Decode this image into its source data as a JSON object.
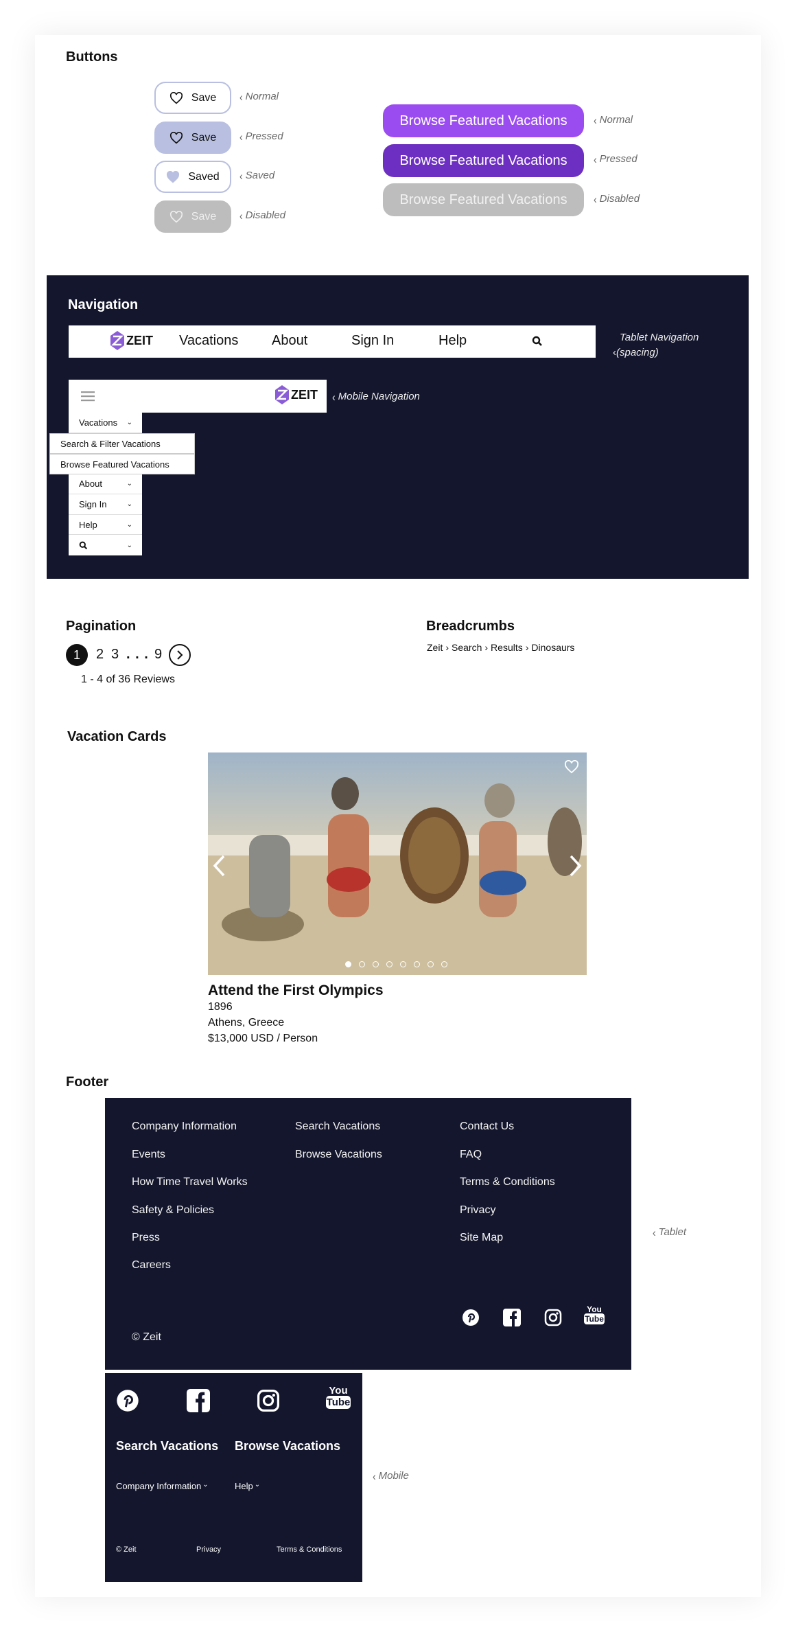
{
  "buttons": {
    "title": "Buttons",
    "save": [
      {
        "label": "Save",
        "state": "Normal"
      },
      {
        "label": "Save",
        "state": "Pressed"
      },
      {
        "label": "Saved",
        "state": "Saved"
      },
      {
        "label": "Save",
        "state": "Disabled"
      }
    ],
    "browse": [
      {
        "label": "Browse Featured Vacations",
        "state": "Normal"
      },
      {
        "label": "Browse Featured Vacations",
        "state": "Pressed"
      },
      {
        "label": "Browse Featured Vacations",
        "state": "Disabled"
      }
    ],
    "colors": {
      "normal": "#9b4cf0",
      "pressed": "#6d2fc1",
      "disabled": "#bdbdbd",
      "save_border": "#b8bfe0"
    }
  },
  "navigation": {
    "title": "Navigation",
    "logo_text": "ZEIT",
    "tablet_items": [
      "Vacations",
      "About",
      "Sign In",
      "Help"
    ],
    "tablet_note_line1": "Tablet Navigation",
    "tablet_note_line2": "(spacing)",
    "mobile_note": "Mobile Navigation",
    "mobile_menu": [
      "Vacations",
      "About",
      "Sign In",
      "Help"
    ],
    "submenu": [
      "Search & Filter Vacations",
      "Browse Featured Vacations"
    ],
    "panel_color": "#13162c"
  },
  "pagination": {
    "title": "Pagination",
    "current": "1",
    "pages": [
      "2",
      "3",
      ". . .",
      "9"
    ],
    "summary": "1 - 4 of 36 Reviews"
  },
  "breadcrumbs": {
    "title": "Breadcrumbs",
    "items": [
      "Zeit",
      "Search",
      "Results",
      "Dinosaurs"
    ]
  },
  "vacation_cards": {
    "title": "Vacation Cards",
    "card": {
      "name": "Attend the First Olympics",
      "year": "1896",
      "location": "Athens, Greece",
      "price": "$13,000 USD / Person",
      "slide_count": 8,
      "active_slide": 1
    }
  },
  "footer": {
    "title": "Footer",
    "tablet_note": "Tablet",
    "mobile_note": "Mobile",
    "col1": [
      "Company Information",
      "Events",
      "How Time Travel Works",
      "Safety & Policies",
      "Press",
      "Careers"
    ],
    "col2": [
      "Search Vacations",
      "Browse Vacations"
    ],
    "col3": [
      "Contact Us",
      "FAQ",
      "Terms & Conditions",
      "Privacy",
      "Site Map"
    ],
    "copyright": "© Zeit",
    "social": [
      "pinterest-icon",
      "facebook-icon",
      "instagram-icon",
      "youtube-icon"
    ],
    "youtube_text_top": "You",
    "youtube_text_bottom": "Tube",
    "mobile": {
      "headline_left": "Search Vacations",
      "headline_right": "Browse Vacations",
      "dropdown_left": "Company Information",
      "dropdown_right": "Help",
      "copyright": "© Zeit",
      "privacy": "Privacy",
      "terms": "Terms & Conditions"
    }
  }
}
